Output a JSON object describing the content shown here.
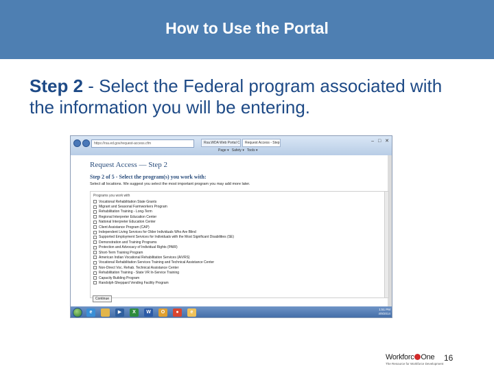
{
  "slide": {
    "title": "How to Use the Portal",
    "step_label": "Step 2",
    "step_body": " - Select the Federal program associated with the information you will be entering.",
    "page_number": "16"
  },
  "browser": {
    "address": "https://rsa.ed.gov/request-access.cfm",
    "tabs": [
      "Rsa.WDA Web Portal Co...",
      "Request Access - Step 2"
    ],
    "toolbar": [
      "Page ▾",
      "Safety ▾",
      "Tools ▾"
    ],
    "window_controls": "– □ ✕"
  },
  "form": {
    "heading": "Request Access — Step 2",
    "subheading": "Step 2 of 5 - Select the program(s) you work with:",
    "instructions": "Select all locations. We suggest you select the most important program you may add more later.",
    "list_header": "Programs you work with",
    "programs": [
      "Vocational Rehabilitation State Grants",
      "Migrant and Seasonal Farmworkers Program",
      "Rehabilitation Training - Long-Term",
      "Regional Interpreter Education Center",
      "National Interpreter Education Center",
      "Client Assistance Program (CAP)",
      "Independent Living Services for Older Individuals Who Are Blind",
      "Supported Employment Services for Individuals with the Most Significant Disabilities (SE)",
      "Demonstration and Training Programs",
      "Protection and Advocacy of Individual Rights (PAIR)",
      "Short-Term Training Program",
      "American Indian Vocational Rehabilitation Services (AIVRS)",
      "Vocational Rehabilitation Services Training and Technical Assistance Center",
      "Non-Direct Voc. Rehab. Technical Assistance Center",
      "Rehabilitation Training - State VR In-Service Training",
      "Capacity Building Program",
      "Randolph-Sheppard Vending Facility Program"
    ],
    "continue_label": "Continue"
  },
  "taskbar": {
    "icons": [
      "ie",
      "folder",
      "media",
      "excel",
      "word",
      "outlook",
      "chrome",
      "ie2"
    ],
    "time": "1:51 PM",
    "date": "4/9/2014"
  },
  "footer": {
    "logo_word_left": "Workforc",
    "logo_word_right": "One",
    "logo_tagline": "The Resource for Workforce Development"
  }
}
